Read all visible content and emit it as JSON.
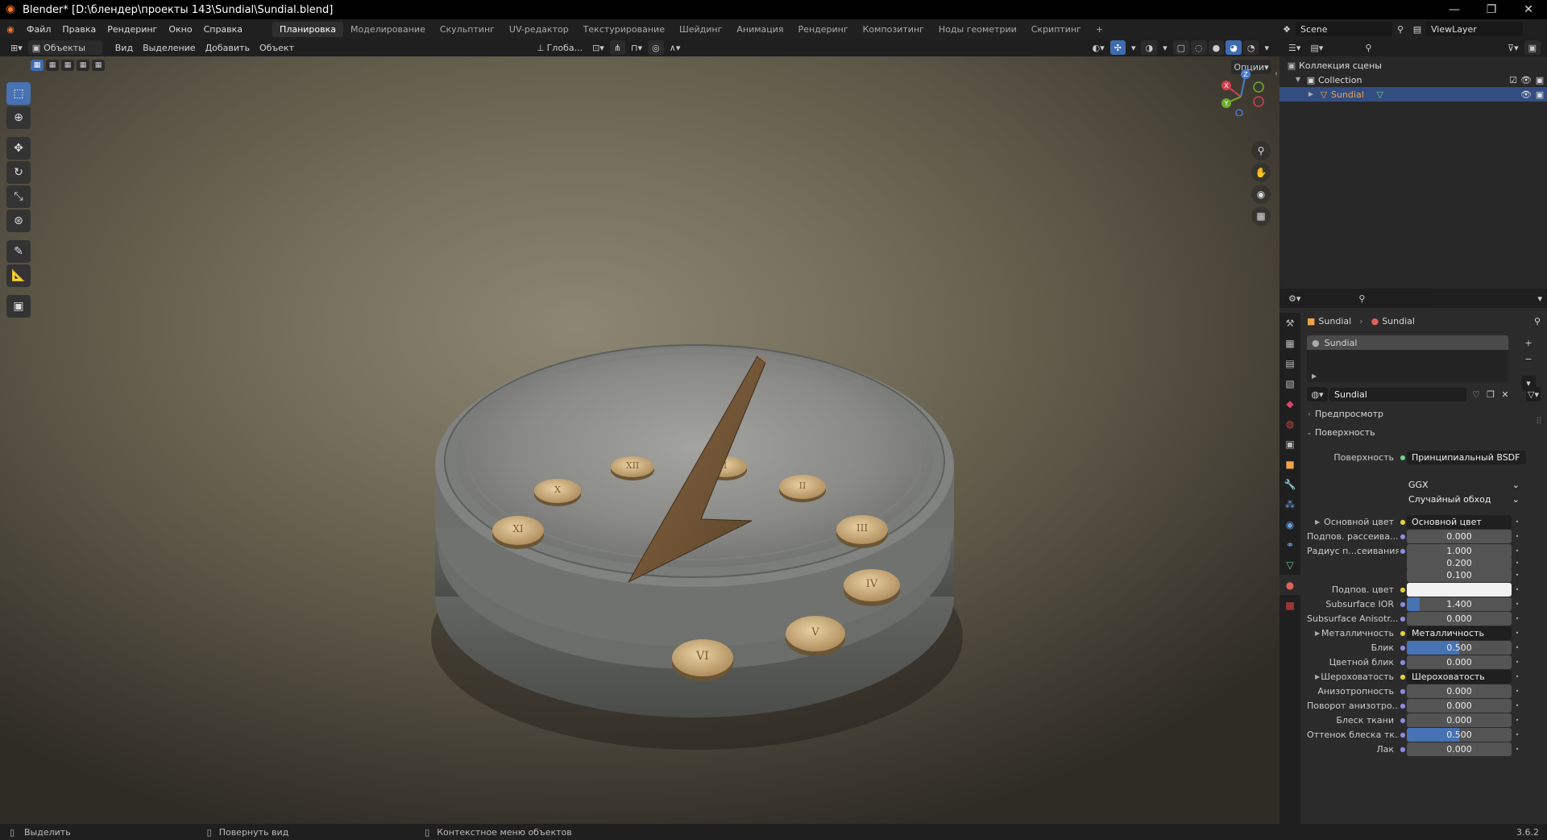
{
  "window": {
    "title": "Blender* [D:\\блендер\\проекты 143\\Sundial\\Sundial.blend]",
    "controls": [
      "—",
      "❐",
      "✕"
    ]
  },
  "menu": [
    "Файл",
    "Правка",
    "Рендеринг",
    "Окно",
    "Справка"
  ],
  "workspaces": [
    "Планировка",
    "Моделирование",
    "Скульптинг",
    "UV-редактор",
    "Текстурирование",
    "Шейдинг",
    "Анимация",
    "Рендеринг",
    "Композитинг",
    "Ноды геометрии",
    "Скриптинг"
  ],
  "active_workspace": "Планировка",
  "add_workspace": "+",
  "scene": "Scene",
  "view_layer": "ViewLayer",
  "viewport": {
    "mode": "Объекты",
    "menus": [
      "Вид",
      "Выделение",
      "Добавить",
      "Объект"
    ],
    "orientation": "Глоба...",
    "options": "Опции",
    "gizmo": {
      "x": "X",
      "y": "Y",
      "z": "Z"
    },
    "numerals": [
      "XI",
      "XII",
      "I",
      "II",
      "III",
      "IV",
      "V",
      "VI",
      "X"
    ]
  },
  "outliner": {
    "root": "Коллекция сцены",
    "collection": "Collection",
    "object": "Sundial"
  },
  "properties": {
    "breadcrumb_object": "Sundial",
    "breadcrumb_material": "Sundial",
    "slot": "Sundial",
    "material_name": "Sundial",
    "panel_preview": "Предпросмотр",
    "panel_surface": "Поверхность",
    "surface_label": "Поверхность",
    "surface_value": "Принципиальный BSDF",
    "distribution": "GGX",
    "subsurface_method": "Случайный обход",
    "rows": [
      {
        "label": "Основной цвет",
        "value": "Основной цвет",
        "kind": "link"
      },
      {
        "label": "Подпов. рассеива...",
        "value": "0.000",
        "kind": "num",
        "fill": 0
      },
      {
        "label": "Радиус п...сеивания",
        "value": "1.000",
        "kind": "num",
        "fill": 0
      },
      {
        "label": "",
        "value": "0.200",
        "kind": "num",
        "fill": 0
      },
      {
        "label": "",
        "value": "0.100",
        "kind": "num",
        "fill": 0
      },
      {
        "label": "Подпов. цвет",
        "value": "",
        "kind": "color"
      },
      {
        "label": "Subsurface IOR",
        "value": "1.400",
        "kind": "num",
        "fill": 0.12
      },
      {
        "label": "Subsurface Anisotr...",
        "value": "0.000",
        "kind": "num",
        "fill": 0
      },
      {
        "label": "Металличность",
        "value": "Металличность",
        "kind": "link"
      },
      {
        "label": "Блик",
        "value": "0.500",
        "kind": "num",
        "fill": 0.5
      },
      {
        "label": "Цветной блик",
        "value": "0.000",
        "kind": "num",
        "fill": 0
      },
      {
        "label": "Шероховатость",
        "value": "Шероховатость",
        "kind": "link"
      },
      {
        "label": "Анизотропность",
        "value": "0.000",
        "kind": "num",
        "fill": 0
      },
      {
        "label": "Поворот анизотро...",
        "value": "0.000",
        "kind": "num",
        "fill": 0
      },
      {
        "label": "Блеск ткани",
        "value": "0.000",
        "kind": "num",
        "fill": 0
      },
      {
        "label": "Оттенок блеска тк...",
        "value": "0.500",
        "kind": "num",
        "fill": 0.5
      },
      {
        "label": "Лак",
        "value": "0.000",
        "kind": "num",
        "fill": 0
      }
    ]
  },
  "status": {
    "select": "Выделить",
    "rotate": "Повернуть вид",
    "context": "Контекстное меню объектов",
    "version": "3.6.2"
  }
}
